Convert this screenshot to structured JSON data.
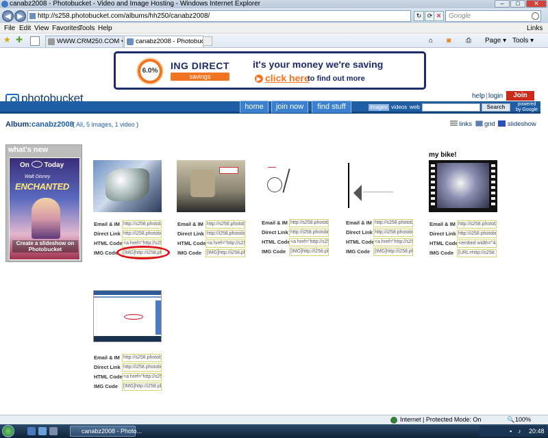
{
  "window": {
    "title": "canabz2008 - Photobucket - Video and Image Hosting - Windows Internet Explorer",
    "minimize": "–",
    "maximize": "□",
    "close": "✕"
  },
  "address": {
    "url": "http://s258.photobucket.com/albums/hh250/canabz2008/",
    "search_placeholder": "Google"
  },
  "menu": [
    "File",
    "Edit",
    "View",
    "Favorites",
    "Tools",
    "Help"
  ],
  "menu_right": "Links",
  "tabs": [
    {
      "label": "WWW.CRM250.COM • Pos..."
    },
    {
      "label": "canabz2008 - Photobuc...",
      "active": true
    }
  ],
  "toolbar": {
    "page": "Page",
    "tools": "Tools"
  },
  "ad": {
    "badge": "6.0%",
    "brand": "ING DIRECT",
    "savings": "savings",
    "line1": "it's your money we're saving",
    "click": "click here",
    "rest": "to find out more"
  },
  "photobucket": {
    "logo": "photobucket",
    "help": "help",
    "login": "login",
    "join": "Join Now",
    "nav": [
      "home",
      "join now",
      "find stuff"
    ],
    "search_segments": [
      "images",
      "videos",
      "web"
    ],
    "search_button": "Search",
    "powered_by": "powered by Google"
  },
  "album": {
    "label": "Album:",
    "name": "canabz2008",
    "count_open": "( ",
    "all": "All",
    "images": "5 images",
    "videos": "1 video",
    "count_close": " )",
    "views": [
      "links",
      "grid",
      "slideshow"
    ]
  },
  "whats_new": {
    "title": "what's new",
    "on": "On",
    "today": "Today",
    "disney": "Walt Disney",
    "movie": "ENCHANTED",
    "caption": "Create a slideshow on Photobucket"
  },
  "field_labels": [
    "Email & IM",
    "Direct Link",
    "HTML Code",
    "IMG Code"
  ],
  "items": [
    {
      "title": "",
      "fields": [
        "http://s258.photobu",
        "http://i258.photobu",
        "<a href=\"http://s25",
        "[IMG]http://i258.ph"
      ]
    },
    {
      "title": "",
      "fields": [
        "http://s258.photobu",
        "http://i258.photobu",
        "<a href=\"http://s25",
        "[IMG]http://i258.ph"
      ]
    },
    {
      "title": "",
      "fields": [
        "http://s258.photobu",
        "http://i258.photobu",
        "<a href=\"http://s25",
        "[IMG]http://i258.ph"
      ]
    },
    {
      "title": "",
      "fields": [
        "http://s258.photobu",
        "http://i258.photobu",
        "<a href=\"http://s25",
        "[IMG]http://i258.ph"
      ]
    },
    {
      "title": "my bike!",
      "fields": [
        "http://s258.photobu",
        "http://i258.photobu",
        "<embed width=\"44",
        "[URL=http://s258.ph"
      ]
    },
    {
      "title": "",
      "fields": [
        "http://s258.photobu",
        "http://i258.photobu",
        "<a href=\"http://s25",
        "[IMG]http://i258.ph"
      ]
    }
  ],
  "status": {
    "zone": "Internet | Protected Mode: On",
    "zoom": "100%"
  },
  "taskbar": {
    "window": "canabz2008 - Photo...",
    "clock": "20:48"
  }
}
